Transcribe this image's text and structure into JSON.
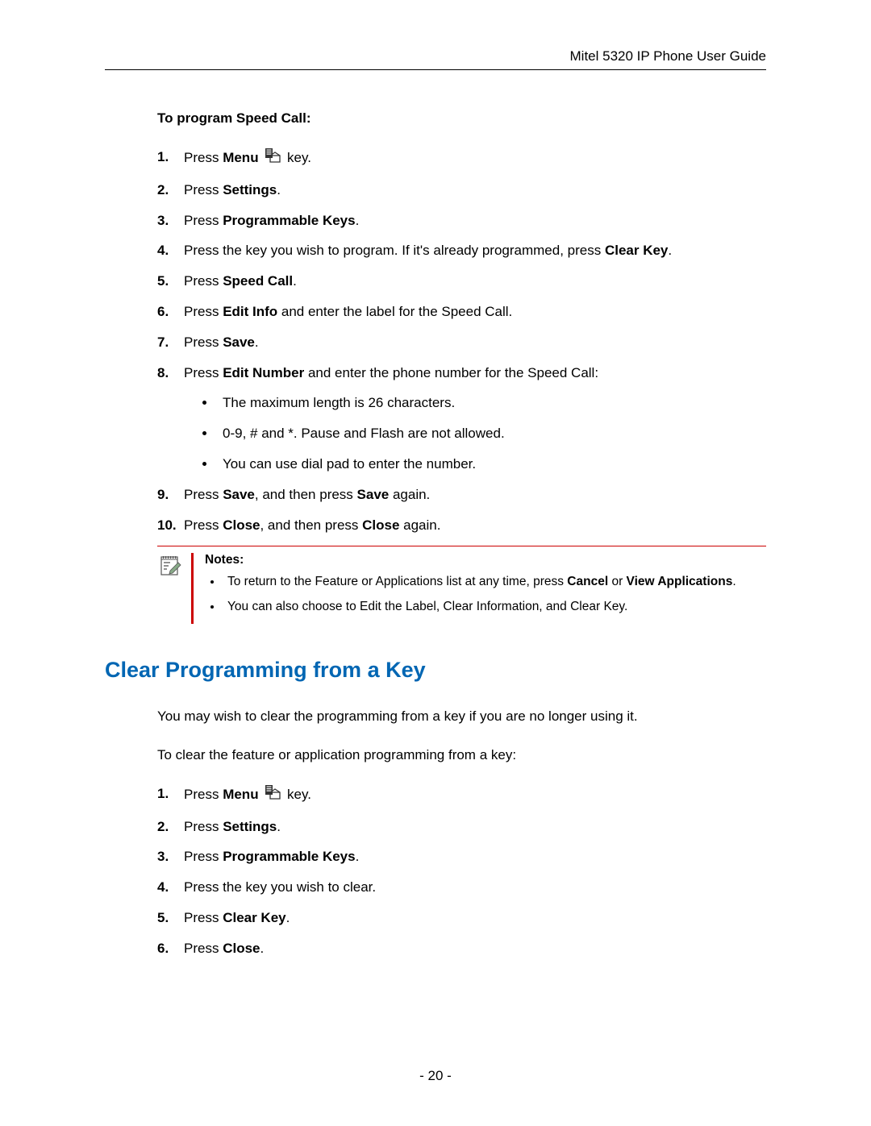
{
  "header": {
    "title": "Mitel 5320 IP Phone User Guide"
  },
  "section1": {
    "title": "To program Speed Call:",
    "steps": {
      "s1a": "Press ",
      "s1b": "Menu",
      "s1c": " key.",
      "s2a": "Press ",
      "s2b": "Settings",
      "s2c": ".",
      "s3a": "Press ",
      "s3b": "Programmable Keys",
      "s3c": ".",
      "s4a": "Press the key you wish to program. If it's already programmed, press ",
      "s4b": "Clear Key",
      "s4c": ".",
      "s5a": "Press ",
      "s5b": "Speed Call",
      "s5c": ".",
      "s6a": "Press ",
      "s6b": "Edit Info",
      "s6c": " and enter the label for the Speed Call.",
      "s7a": "Press ",
      "s7b": "Save",
      "s7c": ".",
      "s8a": "Press ",
      "s8b": "Edit Number",
      "s8c": " and enter the phone number for the Speed Call:",
      "s8_sub1": "The maximum length is 26 characters.",
      "s8_sub2": "0-9, # and *. Pause and Flash are not allowed.",
      "s8_sub3": "You can use dial pad to enter the number.",
      "s9a": "Press ",
      "s9b": "Save",
      "s9c": ", and then press ",
      "s9d": "Save",
      "s9e": " again.",
      "s10a": "Press ",
      "s10b": "Close",
      "s10c": ", and then press ",
      "s10d": "Close",
      "s10e": " again."
    }
  },
  "notes": {
    "label": "Notes",
    "colon": ":",
    "n1a": "To return to the Feature or Applications list at any time, press ",
    "n1b": "Cancel",
    "n1c": " or ",
    "n1d": "View Applications",
    "n1e": ".",
    "n2": "You can also choose to Edit the Label, Clear Information, and Clear Key."
  },
  "heading2": "Clear Programming from a Key",
  "para1": "You may wish to clear the programming from a key if you are no longer using it.",
  "para2": "To clear the feature or application programming from a key:",
  "section2": {
    "s1a": "Press ",
    "s1b": "Menu",
    "s1c": " key.",
    "s2a": "Press ",
    "s2b": "Settings",
    "s2c": ".",
    "s3a": "Press ",
    "s3b": "Programmable Keys",
    "s3c": ".",
    "s4": "Press the key you wish to clear.",
    "s5a": "Press ",
    "s5b": "Clear Key",
    "s5c": ".",
    "s6a": "Press ",
    "s6b": "Close",
    "s6c": "."
  },
  "pagenum": "- 20 -"
}
